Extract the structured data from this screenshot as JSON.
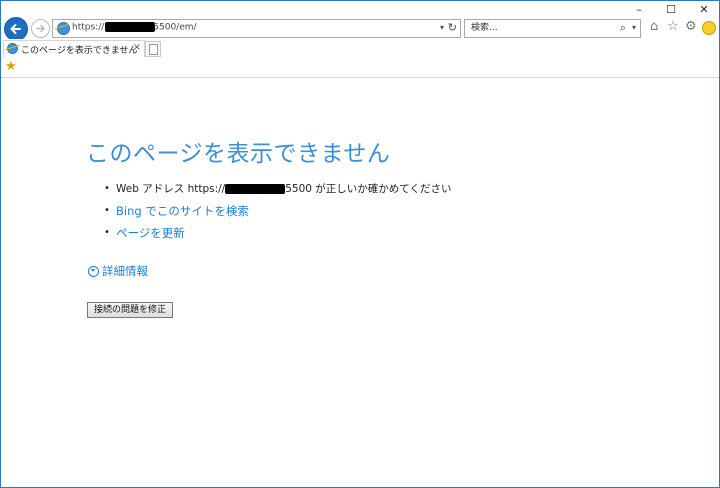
{
  "window": {
    "minimize": "–",
    "maximize": "☐",
    "close": "✕"
  },
  "address_bar": {
    "url_prefix": "https://",
    "url_suffix": "5500/em/",
    "dropdown_glyph": "▾",
    "refresh_glyph": "↻"
  },
  "search": {
    "placeholder": "検索...",
    "icon_glyph": "⌕",
    "dropdown_glyph": "▾"
  },
  "toolbar_icons": {
    "home": "⌂",
    "favorites": "☆",
    "settings": "⚙"
  },
  "tab": {
    "title": "このページを表示できません",
    "close_glyph": "×"
  },
  "favorites_bar": {
    "icon_glyph": "★"
  },
  "error_page": {
    "title": "このページを表示できません",
    "bullet": "•",
    "items": {
      "check_address_prefix": "Web アドレス https://",
      "check_address_suffix": "5500 が正しいか確かめてください",
      "search_bing": "Bing でこのサイトを検索",
      "refresh": "ページを更新"
    },
    "details_label": "詳細情報",
    "fix_button": "接続の問題を修正"
  },
  "colors": {
    "title_blue": "#3c8fd6",
    "link_blue": "#1a7fd0",
    "frame_blue": "#2b78c5"
  }
}
